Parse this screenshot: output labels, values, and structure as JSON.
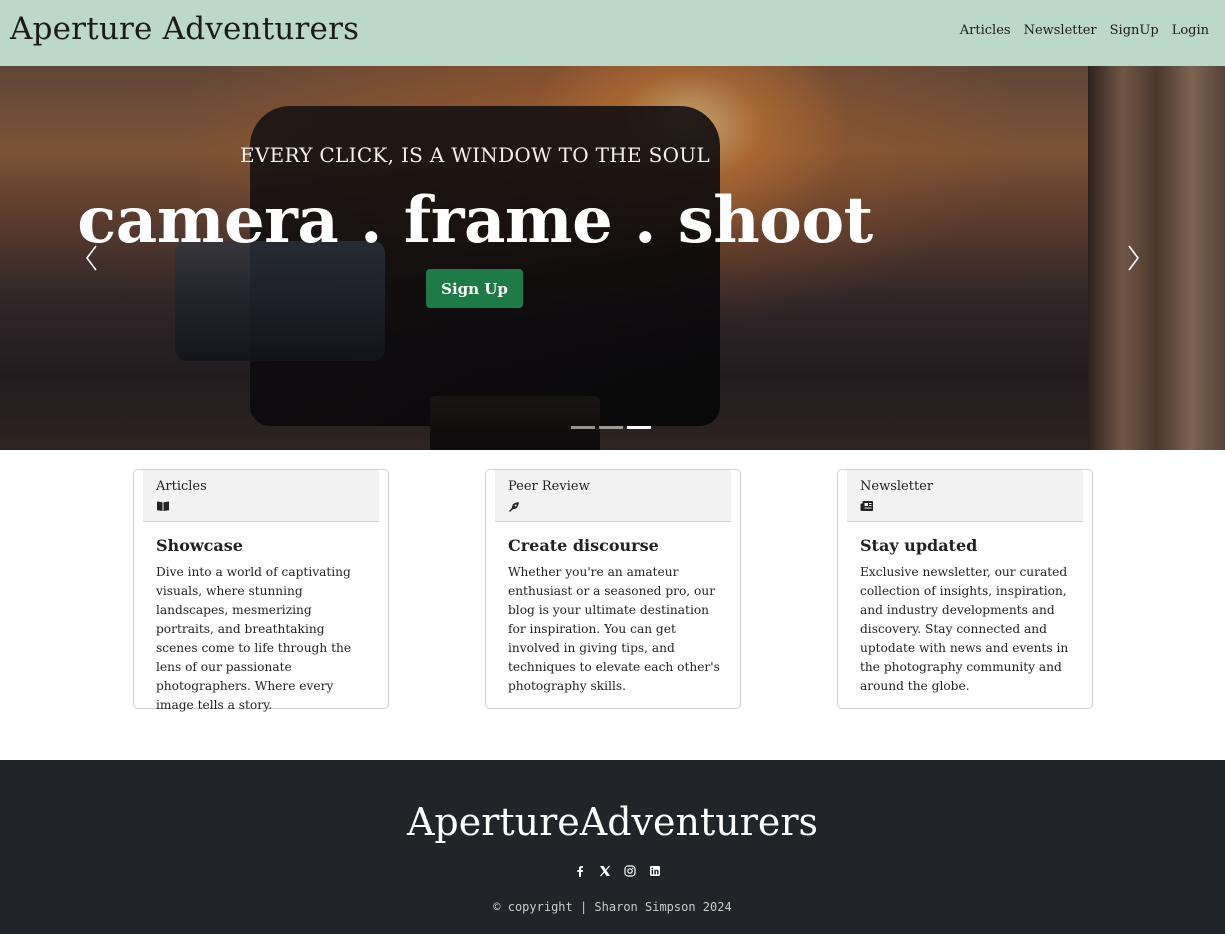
{
  "navbar": {
    "brand": "Aperture Adventurers",
    "links": [
      "Articles",
      "Newsletter",
      "SignUp",
      "Login"
    ]
  },
  "hero": {
    "tagline": "EVERY CLICK, IS A WINDOW TO THE SOUL",
    "headline": "camera . frame . shoot",
    "cta_label": "Sign Up",
    "prev_icon": "chevron-left-icon",
    "next_icon": "chevron-right-icon",
    "slides_count": 3,
    "active_slide": 3
  },
  "cards": [
    {
      "label": "Articles",
      "icon": "book-open-icon",
      "title": "Showcase",
      "text": "Dive into a world of captivating visuals, where stunning landscapes, mesmerizing portraits, and breathtaking scenes come to life through the lens of our passionate photographers. Where every image tells a story."
    },
    {
      "label": "Peer Review",
      "icon": "pen-nib-icon",
      "title": "Create discourse",
      "text": "Whether you're an amateur enthusiast or a seasoned pro, our blog is your ultimate destination for inspiration. You can get involved in giving tips, and techniques to elevate each other's photography skills."
    },
    {
      "label": "Newsletter",
      "icon": "newspaper-icon",
      "title": "Stay updated",
      "text": "Exclusive newsletter, our curated collection of insights, inspiration, and industry developments and discovery. Stay connected and uptodate with news and events in the photography community and around the globe."
    }
  ],
  "footer": {
    "brand": "ApertureAdventurers",
    "socials": [
      "facebook-icon",
      "x-icon",
      "instagram-icon",
      "linkedin-icon"
    ],
    "copyright": "© copyright | Sharon Simpson 2024"
  },
  "colors": {
    "navbar_bg": "#bcd8c9",
    "cta_bg": "#1e7b45",
    "footer_bg": "#212529"
  }
}
